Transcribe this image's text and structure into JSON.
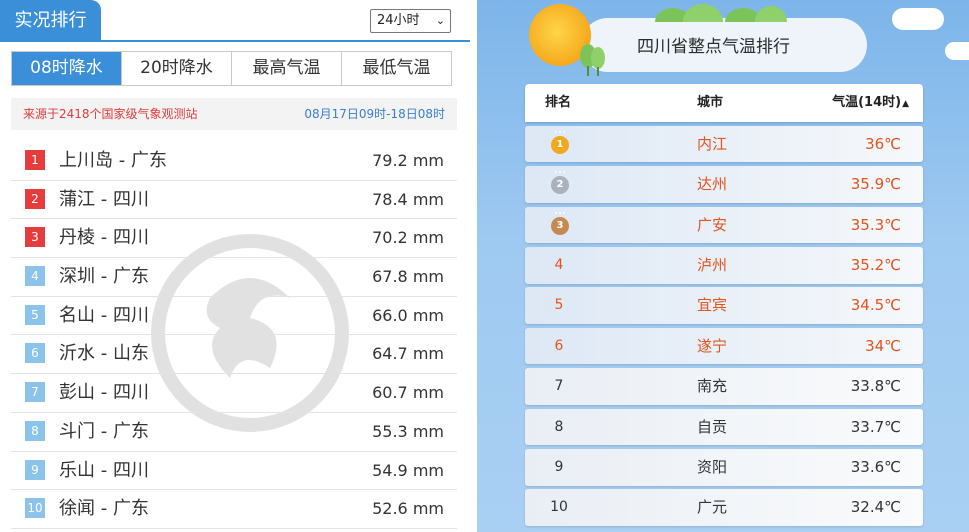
{
  "left": {
    "title": "实况排行",
    "period_select": "24小时",
    "tabs": [
      "08时降水",
      "20时降水",
      "最高气温",
      "最低气温"
    ],
    "active_tab": 0,
    "source": "来源于2418个国家级气象观测站",
    "time_range": "08月17日09时-18日08时",
    "rows": [
      {
        "rank": "1",
        "name": "上川岛 - 广东",
        "value": "79.2 mm"
      },
      {
        "rank": "2",
        "name": "蒲江 - 四川",
        "value": "78.4 mm"
      },
      {
        "rank": "3",
        "name": "丹棱 - 四川",
        "value": "70.2 mm"
      },
      {
        "rank": "4",
        "name": "深圳 - 广东",
        "value": "67.8 mm"
      },
      {
        "rank": "5",
        "name": "名山 - 四川",
        "value": "66.0 mm"
      },
      {
        "rank": "6",
        "name": "沂水 - 山东",
        "value": "64.7 mm"
      },
      {
        "rank": "7",
        "name": "彭山 - 四川",
        "value": "60.7 mm"
      },
      {
        "rank": "8",
        "name": "斗门 - 广东",
        "value": "55.3 mm"
      },
      {
        "rank": "9",
        "name": "乐山 - 四川",
        "value": "54.9 mm"
      },
      {
        "rank": "10",
        "name": "徐闻 - 广东",
        "value": "52.6 mm"
      }
    ],
    "colors": {
      "accent": "#3a8fd8",
      "top_rank": "#e53d3d",
      "rank": "#8cc3ea",
      "source": "#e23b3b"
    }
  },
  "right": {
    "title": "四川省整点气温排行",
    "headers": {
      "rank": "排名",
      "city": "城市",
      "temp": "气温(14时)"
    },
    "sort_icon": "sort-up-icon",
    "rows": [
      {
        "rank": "1",
        "medal": "gold",
        "city": "内江",
        "temp": "36℃"
      },
      {
        "rank": "2",
        "medal": "silver",
        "city": "达州",
        "temp": "35.9℃"
      },
      {
        "rank": "3",
        "medal": "bronze",
        "city": "广安",
        "temp": "35.3℃"
      },
      {
        "rank": "4",
        "medal": "",
        "city": "泸州",
        "temp": "35.2℃"
      },
      {
        "rank": "5",
        "medal": "",
        "city": "宜宾",
        "temp": "34.5℃"
      },
      {
        "rank": "6",
        "medal": "",
        "city": "遂宁",
        "temp": "34℃"
      },
      {
        "rank": "7",
        "medal": "",
        "city": "南充",
        "temp": "33.8℃"
      },
      {
        "rank": "8",
        "medal": "",
        "city": "自贡",
        "temp": "33.7℃"
      },
      {
        "rank": "9",
        "medal": "",
        "city": "资阳",
        "temp": "33.6℃"
      },
      {
        "rank": "10",
        "medal": "",
        "city": "广元",
        "temp": "32.4℃"
      }
    ],
    "colors": {
      "hot": "#e2541e",
      "normal": "#333333",
      "sky": "#7db5ea",
      "sun": "#f6a91c"
    }
  }
}
